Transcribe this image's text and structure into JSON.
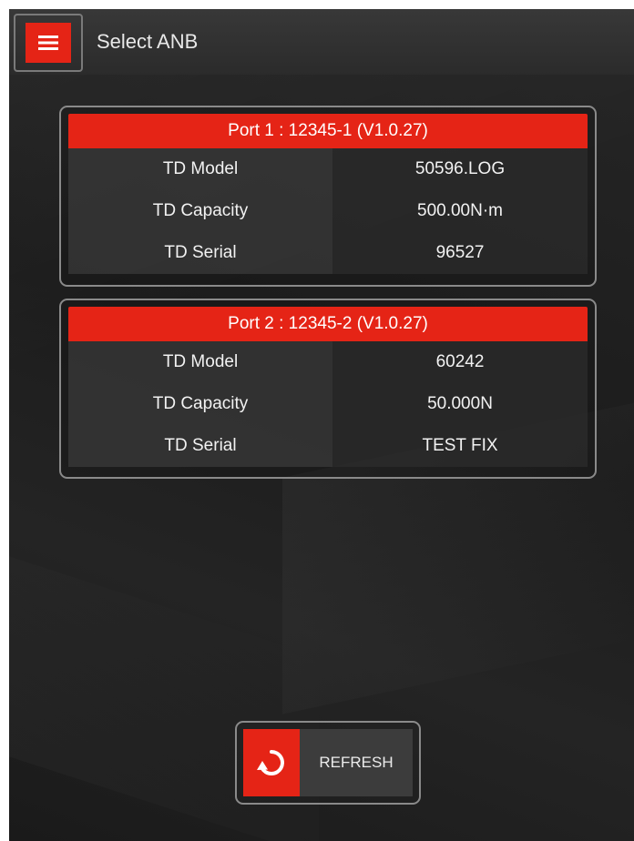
{
  "header": {
    "title": "Select ANB",
    "menu_icon": "hamburger-menu-icon"
  },
  "ports": [
    {
      "title": "Port 1 : 12345-1 (V1.0.27)",
      "rows": [
        {
          "label": "TD Model",
          "value": "50596.LOG"
        },
        {
          "label": "TD Capacity",
          "value": "500.00N·m"
        },
        {
          "label": "TD Serial",
          "value": "96527"
        }
      ]
    },
    {
      "title": "Port 2 : 12345-2 (V1.0.27)",
      "rows": [
        {
          "label": "TD Model",
          "value": "60242"
        },
        {
          "label": "TD Capacity",
          "value": "50.000N"
        },
        {
          "label": "TD Serial",
          "value": "TEST FIX"
        }
      ]
    }
  ],
  "refresh": {
    "label": "REFRESH",
    "icon": "refresh-icon"
  },
  "colors": {
    "accent": "#e52416",
    "background": "#1f1f1f",
    "header": "#333333",
    "border": "#8a8a8a"
  }
}
